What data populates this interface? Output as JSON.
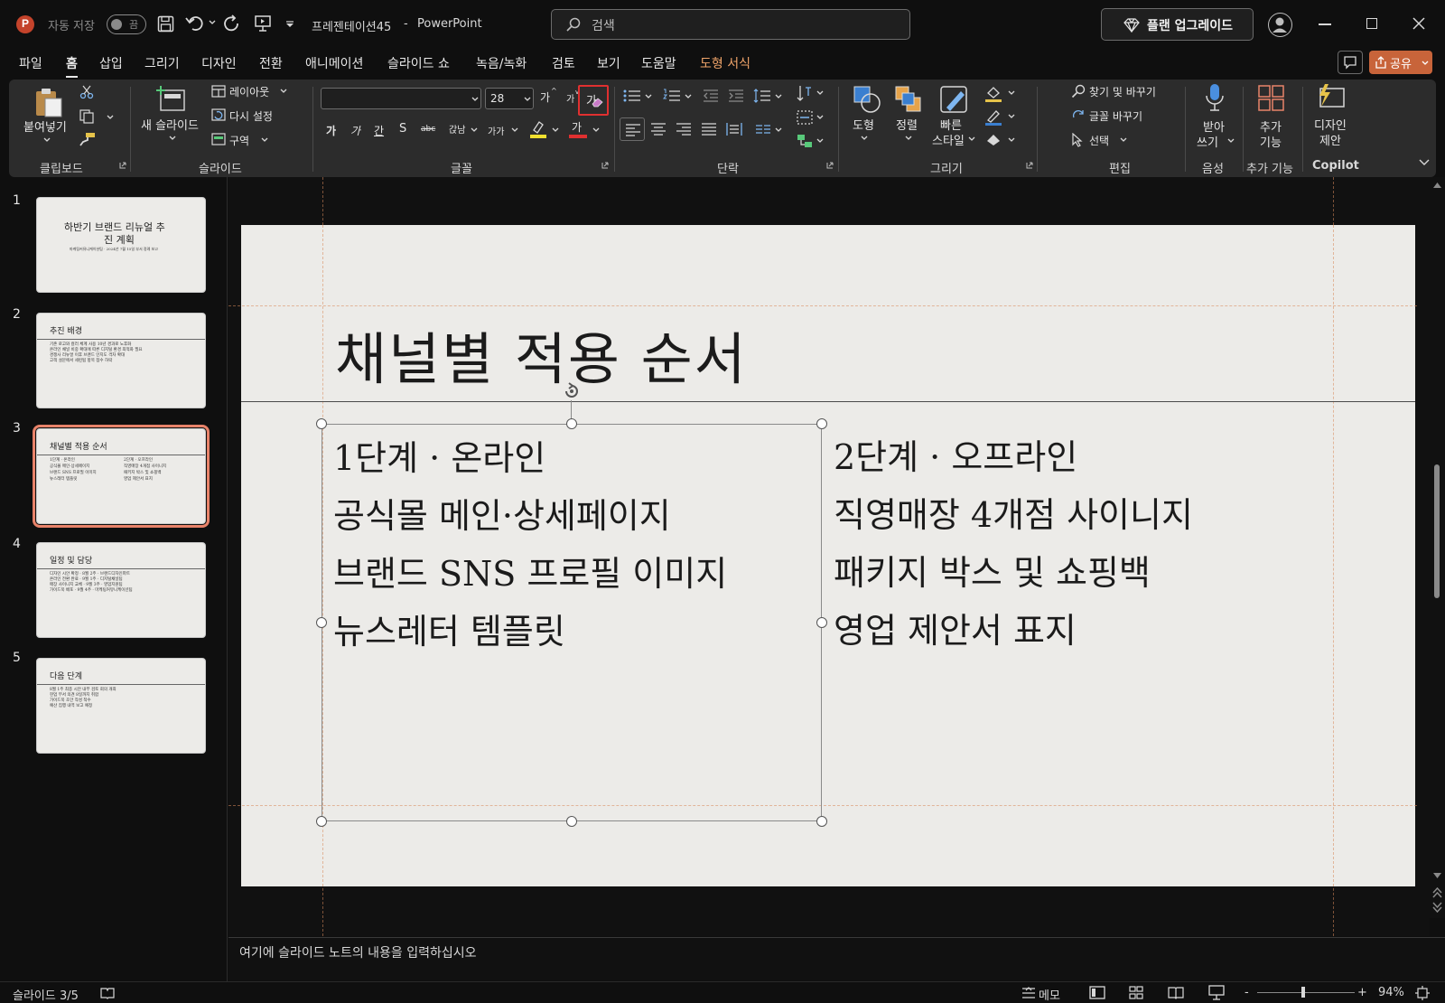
{
  "titlebar": {
    "autosave_label": "자동 저장",
    "autosave_state": "끔",
    "document_title": "프레젠테이션45",
    "separator": "-",
    "app_name": "PowerPoint",
    "search_placeholder": "검색",
    "upgrade_label": "플랜 업그레이드"
  },
  "menu": {
    "tabs": [
      "파일",
      "홈",
      "삽입",
      "그리기",
      "디자인",
      "전환",
      "애니메이션",
      "슬라이드 쇼",
      "녹음/녹화",
      "검토",
      "보기",
      "도움말",
      "도형 서식"
    ],
    "active_tab": "홈",
    "share_label": "공유"
  },
  "ribbon": {
    "clipboard": {
      "paste": "붙여넣기",
      "group": "클립보드"
    },
    "slides": {
      "new_slide_line1": "새 슬라이드",
      "layout": "레이아웃",
      "reset": "다시 설정",
      "section": "구역",
      "group": "슬라이드"
    },
    "font": {
      "font_name": "",
      "font_size": "28",
      "grow": "가",
      "shrink": "가",
      "clear_format": "가",
      "bold": "가",
      "italic": "가",
      "underline": "간",
      "shadow": "S",
      "strike": "abc",
      "spacing": "갅남",
      "case": "가가",
      "font_color_glyph": "가",
      "group": "글꼴"
    },
    "paragraph": {
      "group": "단락"
    },
    "drawing": {
      "shapes": "도형",
      "arrange": "정렬",
      "quick_styles_1": "빠른",
      "quick_styles_2": "스타일",
      "group": "그리기"
    },
    "editing": {
      "find_replace": "찾기 및 바꾸기",
      "replace_font": "글꼴 바꾸기",
      "select": "선택",
      "group": "편집"
    },
    "voice": {
      "dictate_1": "받아",
      "dictate_2": "쓰기",
      "group": "음성"
    },
    "addins": {
      "label_1": "추가",
      "label_2": "기능",
      "group": "추가 기능"
    },
    "designer": {
      "label_1": "디자인",
      "label_2": "제안",
      "group": "Copilot"
    }
  },
  "thumbnails": [
    {
      "num": "1",
      "title_1": "하반기 브랜드 리뉴얼 추",
      "title_2": "진 계획",
      "sub": "마케팅커뮤니케이션팀 · 2024년 7월 15일 부서 정례 보고"
    },
    {
      "num": "2",
      "title": "추진 배경",
      "lines": [
        "기존 로고와 컬러 체계 사용 10년 경과로 노후화",
        "온라인 채널 비중 확대에 따른 디지털 환경 최적화 필요",
        "경쟁사 리뉴얼 이후 브랜드 인지도 격차 확대",
        "고객 설문에서 세련됨 항목 점수 하락"
      ]
    },
    {
      "num": "3",
      "title": "채널별 적용 순서",
      "col1": [
        "1단계 · 온라인",
        "공식몰 메인·상세페이지",
        "브랜드 SNS 프로필 이미지",
        "뉴스레터 템플릿"
      ],
      "col2": [
        "2단계 · 오프라인",
        "직영매장 4개점 사이니지",
        "패키지 박스 및 쇼핑백",
        "영업 제안서 표지"
      ]
    },
    {
      "num": "4",
      "title": "일정 및 담당",
      "lines": [
        "디자인 시안 확정 · 8월 2주 · 브랜드디자인파트",
        "온라인 전환 완료 · 9월 1주 · 디지털채널팀",
        "매장 사이니지 교체 · 9월 3주 · 영업지원팀",
        "가이드북 배포 · 9월 4주 · 마케팅커뮤니케이션팀"
      ]
    },
    {
      "num": "5",
      "title": "다음 단계",
      "lines": [
        "8월 1주 최종 시안 내부 검토 회의 개최",
        "현업 부서 의견 8일까지 취합",
        "가이드북 초안 작성 착수",
        "예산 집행 내역 보고 예정"
      ]
    }
  ],
  "slide": {
    "title": "채널별 적용 순서",
    "left_column": [
      "1단계 · 온라인",
      "공식몰 메인·상세페이지",
      "브랜드 SNS 프로필 이미지",
      "뉴스레터 템플릿"
    ],
    "right_column": [
      "2단계 · 오프라인",
      "직영매장 4개점 사이니지",
      "패키지 박스 및 쇼핑백",
      "영업 제안서 표지"
    ]
  },
  "notes_placeholder": "여기에 슬라이드 노트의 내용을 입력하십시오",
  "status": {
    "slide_counter": "슬라이드 3/5",
    "notes_label": "메모",
    "zoom": "94%",
    "zoom_level": 0.47,
    "zoom_minus": "-",
    "zoom_plus": "+"
  },
  "colors": {
    "accent_orange": "#e8836a",
    "share_button": "#c8643a",
    "highlight_box": "#e03030",
    "slide_bg": "#ecebe8"
  }
}
